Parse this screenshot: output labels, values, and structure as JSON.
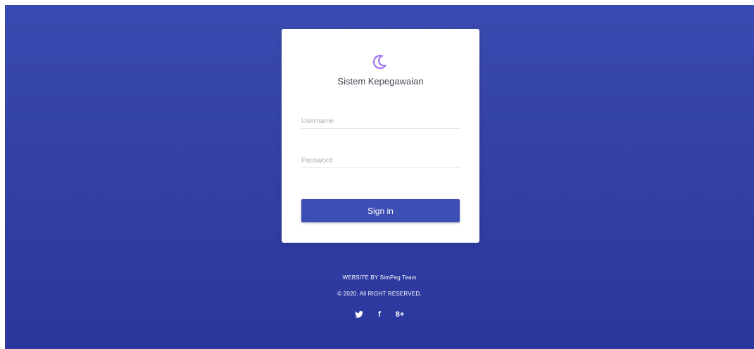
{
  "app": {
    "title": "Sistem Kepegawaian"
  },
  "login": {
    "username_placeholder": "Username",
    "password_placeholder": "Password",
    "signin_label": "Sign in"
  },
  "footer": {
    "credit": "WEBSITE BY SimPeg Team",
    "copyright": "© 2020. All RIGHT RESERVED."
  },
  "social": {
    "facebook_label": "f",
    "googleplus_label": "8+"
  },
  "icons": {
    "logo": "crescent-moon-icon",
    "twitter": "twitter-icon",
    "facebook": "facebook-icon",
    "googleplus": "google-plus-icon"
  },
  "colors": {
    "accent": "#3d4fb4",
    "background_top": "#3b4ab0",
    "background_bottom": "#2b379c",
    "logo": "#a57cf2"
  }
}
